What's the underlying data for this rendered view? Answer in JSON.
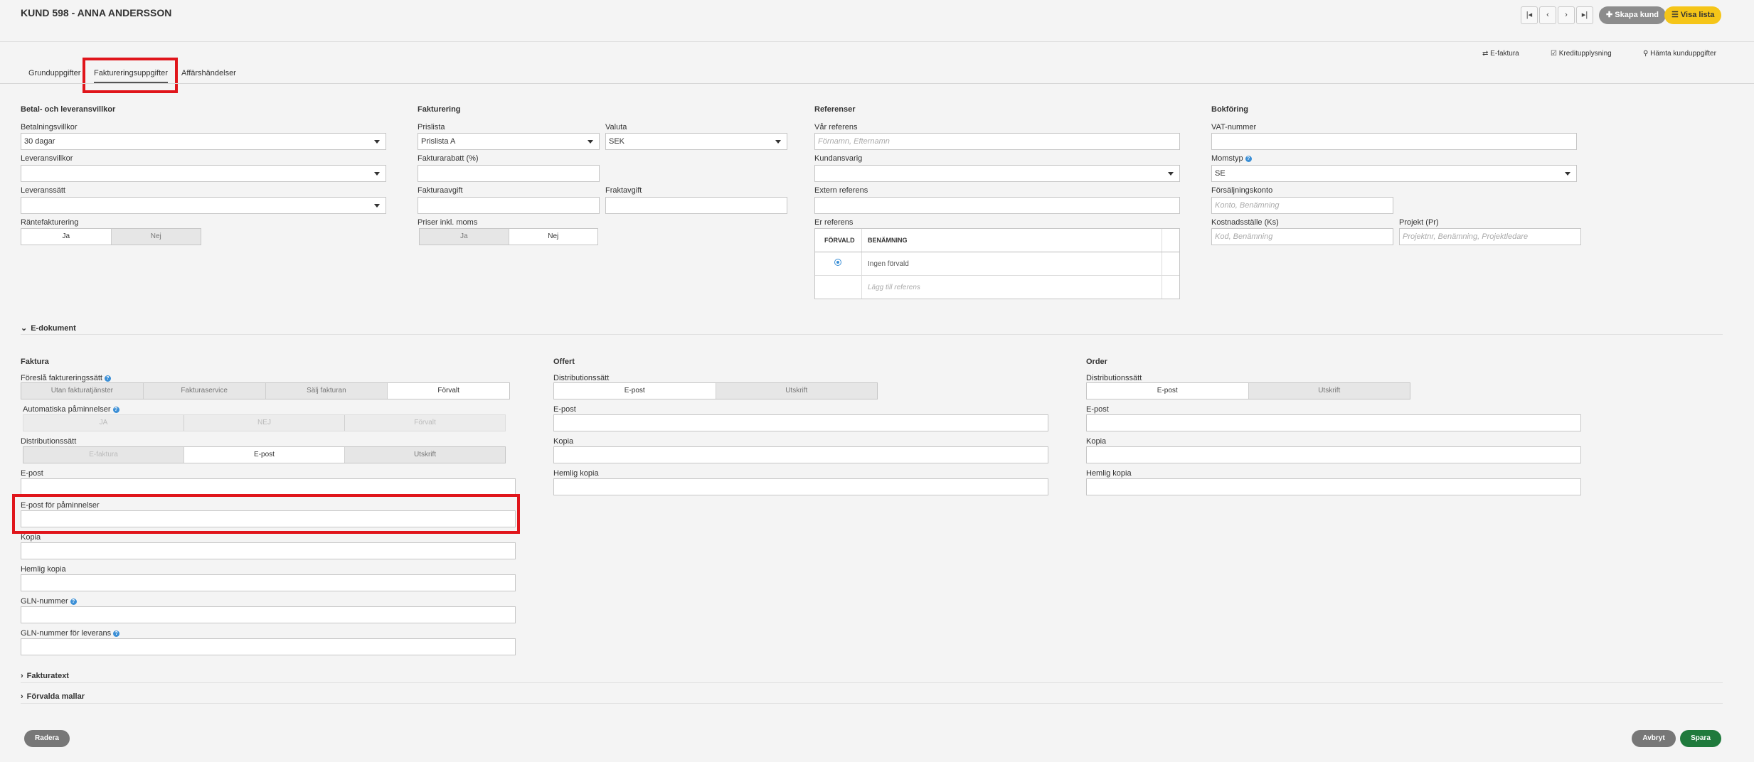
{
  "header": {
    "title": "KUND 598 - ANNA ANDERSSON",
    "nav": [
      "|◂",
      "‹",
      "›",
      "▸|"
    ],
    "create_label": "Skapa kund",
    "list_label": "Visa lista"
  },
  "toplinks": {
    "einvoice": "E-faktura",
    "credit": "Kreditupplysning",
    "fetch": "Hämta kunduppgifter"
  },
  "tabs": [
    "Grunduppgifter",
    "Faktureringsuppgifter",
    "Affärshändelser"
  ],
  "betal": {
    "heading": "Betal- och leveransvillkor",
    "payment_label": "Betalningsvillkor",
    "payment_value": "30 dagar",
    "delivery_terms_label": "Leveransvillkor",
    "delivery_terms_value": "",
    "delivery_method_label": "Leveranssätt",
    "delivery_method_value": "",
    "interest_label": "Räntefakturering",
    "yes": "Ja",
    "no": "Nej"
  },
  "fakturering": {
    "heading": "Fakturering",
    "pricelist_label": "Prislista",
    "pricelist_value": "Prislista A",
    "currency_label": "Valuta",
    "currency_value": "SEK",
    "discount_label": "Fakturarabatt (%)",
    "fee_label": "Fakturaavgift",
    "freight_label": "Fraktavgift",
    "vat_prices_label": "Priser inkl. moms",
    "yes": "Ja",
    "no": "Nej"
  },
  "referenser": {
    "heading": "Referenser",
    "our_ref_label": "Vår referens",
    "our_ref_placeholder": "Förnamn, Efternamn",
    "responsible_label": "Kundansvarig",
    "ext_ref_label": "Extern referens",
    "your_ref_label": "Er referens",
    "col_default": "FÖRVALD",
    "col_name": "BENÄMNING",
    "row_none": "Ingen förvald",
    "add_ref": "Lägg till referens"
  },
  "bokforing": {
    "heading": "Bokföring",
    "vat_number_label": "VAT-nummer",
    "vat_type_label": "Momstyp",
    "vat_type_value": "SE",
    "sales_account_label": "Försäljningskonto",
    "sales_account_placeholder": "Konto, Benämning",
    "cost_center_label": "Kostnadsställe (Ks)",
    "cost_center_placeholder": "Kod, Benämning",
    "project_label": "Projekt (Pr)",
    "project_placeholder": "Projektnr, Benämning, Projektledare"
  },
  "edoc": {
    "heading": "E-dokument",
    "faktura": {
      "heading": "Faktura",
      "suggest_label": "Föreslå faktureringssätt",
      "suggest_options": [
        "Utan fakturatjänster",
        "Fakturaservice",
        "Sälj fakturan",
        "Förvalt"
      ],
      "reminders_label": "Automatiska påminnelser",
      "reminders_options": [
        "JA",
        "NEJ",
        "Förvalt"
      ],
      "distribution_label": "Distributionssätt",
      "distribution_options": [
        "E-faktura",
        "E-post",
        "Utskrift"
      ],
      "email_label": "E-post",
      "reminder_email_label": "E-post för påminnelser",
      "copy_label": "Kopia",
      "bcc_label": "Hemlig kopia",
      "gln_label": "GLN-nummer",
      "gln_delivery_label": "GLN-nummer för leverans"
    },
    "offert": {
      "heading": "Offert",
      "distribution_label": "Distributionssätt",
      "distribution_options": [
        "E-post",
        "Utskrift"
      ],
      "email_label": "E-post",
      "copy_label": "Kopia",
      "bcc_label": "Hemlig kopia"
    },
    "order": {
      "heading": "Order",
      "distribution_label": "Distributionssätt",
      "distribution_options": [
        "E-post",
        "Utskrift"
      ],
      "email_label": "E-post",
      "copy_label": "Kopia",
      "bcc_label": "Hemlig kopia"
    }
  },
  "collapsed": {
    "invoice_text": "Fakturatext",
    "templates": "Förvalda mallar"
  },
  "footer": {
    "delete": "Radera",
    "cancel": "Avbryt",
    "save": "Spara"
  },
  "colors": {
    "highlight": "#e0151b",
    "save": "#1f7a3c",
    "accent": "#f5c518"
  }
}
